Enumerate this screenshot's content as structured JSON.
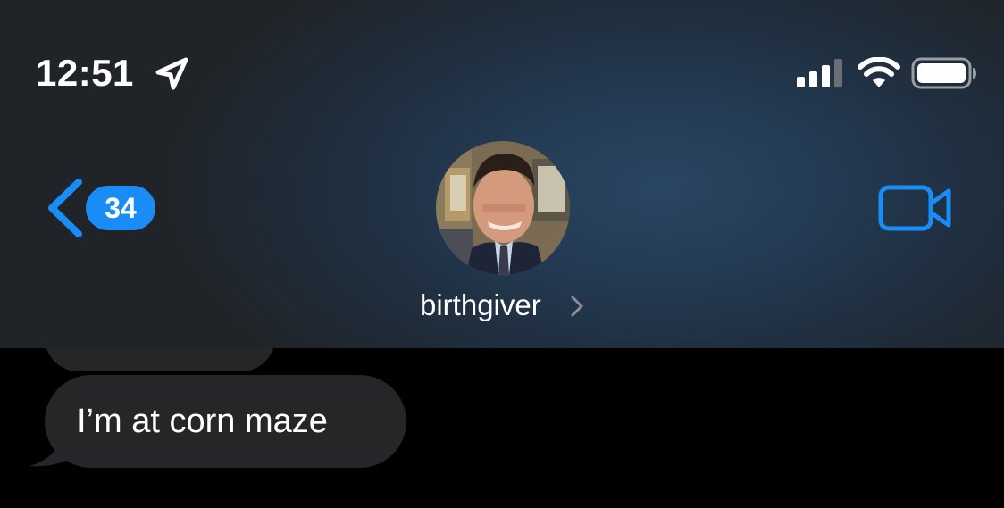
{
  "status_bar": {
    "time": "12:51",
    "location_icon": "location-arrow-icon",
    "signal_icon": "cellular-signal-icon",
    "wifi_icon": "wifi-icon",
    "battery_icon": "battery-icon"
  },
  "nav": {
    "back_icon": "chevron-left-icon",
    "unread_count": "34",
    "contact_name": "birthgiver",
    "contact_chevron_icon": "chevron-right-icon",
    "video_icon": "video-camera-icon",
    "avatar_icon": "contact-avatar"
  },
  "messages": [
    {
      "direction": "incoming",
      "text": ""
    },
    {
      "direction": "incoming",
      "text": "I’m at corn maze"
    }
  ],
  "colors": {
    "accent": "#1a8cf6",
    "incoming_bubble": "#262628",
    "background": "#000000",
    "header": "#1f2c3b"
  }
}
